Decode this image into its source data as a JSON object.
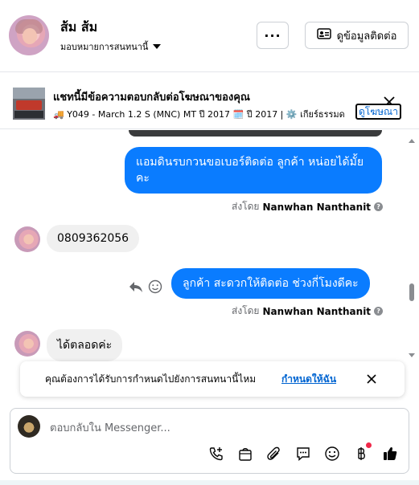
{
  "contact": {
    "name": "ส้ม ส้ม",
    "assign_label": "มอบหมายการสนทนานี้"
  },
  "header": {
    "more_label": "···",
    "contact_info_label": "ดูข้อมูลติดต่อ"
  },
  "ad": {
    "title": "แชทนี้มีข้อความตอบกลับต่อโฆษณาของคุณ",
    "subtitle": "🚚 Y049 - March 1.2 S (MNC) MT ปี 2017 🗓️ ปี 2017 | ⚙️ เกียร์ธรรมด",
    "link_label": "ดูโฆษณา"
  },
  "messages": [
    {
      "direction": "out",
      "text": "แอมดินรบกวนขอเบอร์ติดต่อ ลูกค้า   หน่อยได้มั้ยคะ",
      "sent_by_prefix": "ส่งโดย",
      "sent_by_name": "Nanwhan Nanthanit"
    },
    {
      "direction": "in",
      "text": "0809362056"
    },
    {
      "direction": "out",
      "text": "ลูกค้า  สะดวกให้ติดต่อ ช่วงกี่โมงดีคะ",
      "sent_by_prefix": "ส่งโดย",
      "sent_by_name": "Nanwhan Nanthanit"
    },
    {
      "direction": "in",
      "text": "ได้ตลอดค่ะ"
    }
  ],
  "reminder": {
    "text": "คุณต้องการได้รับการกำหนดไปยังการสนทนานี้ไหม",
    "link_label": "กำหนดให้ฉัน"
  },
  "composer": {
    "placeholder": "ตอบกลับใน Messenger...",
    "tools": [
      "call-add-icon",
      "shopping-bag-icon",
      "attachment-icon",
      "saved-reply-icon",
      "emoji-icon",
      "baht-payment-icon",
      "thumbs-up-icon"
    ]
  },
  "colors": {
    "outgoing_bubble": "#0a7cff",
    "incoming_bubble": "#f0f0f0",
    "link": "#0064d1",
    "notification_dot": "#f02849"
  }
}
